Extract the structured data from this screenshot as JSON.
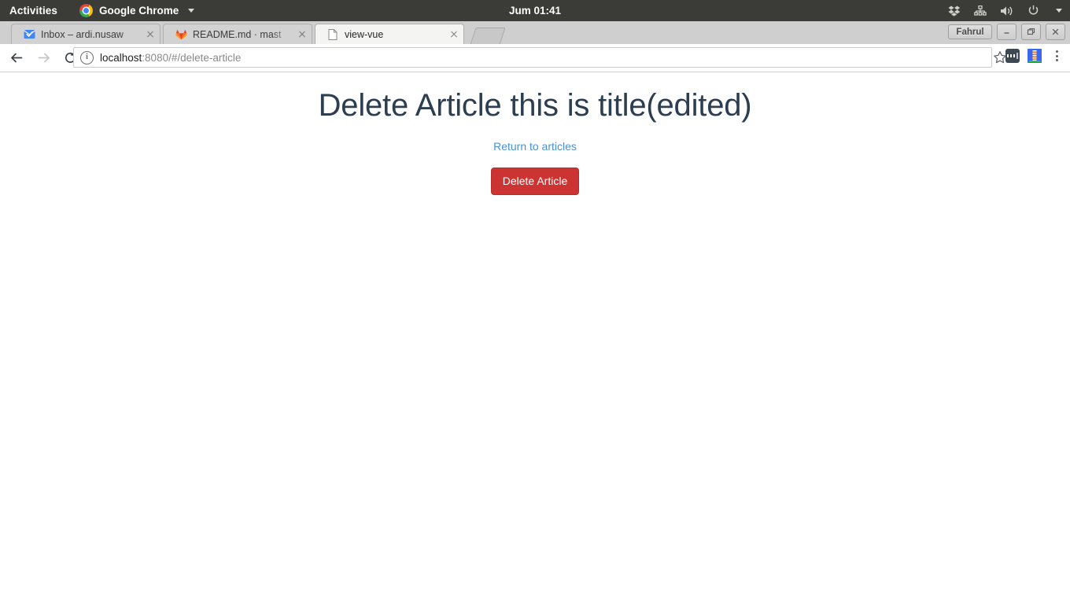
{
  "system_bar": {
    "activities_label": "Activities",
    "app_name": "Google Chrome",
    "clock": "Jum 01:41",
    "tray_icons": [
      "dropbox-icon",
      "network-icon",
      "volume-icon",
      "power-icon",
      "caret-down-icon"
    ]
  },
  "browser": {
    "tabs": [
      {
        "title": "Inbox – ardi.nusaw",
        "favicon": "gmail-icon",
        "active": false
      },
      {
        "title": "README.md · mast",
        "favicon": "gitlab-icon",
        "active": false
      },
      {
        "title": "view-vue",
        "favicon": "document-icon",
        "active": true
      }
    ],
    "new_tab_label": "New tab",
    "window_controls": {
      "profile_name": "Fahrul",
      "minimize": "–",
      "maximize": "❐",
      "close": "✕"
    },
    "toolbar": {
      "back_label": "Back",
      "forward_label": "Forward",
      "reload_label": "Reload",
      "security_icon": "i",
      "url_host": "localhost",
      "url_rest": ":8080/#/delete-article",
      "bookmark_label": "Bookmark this page",
      "extensions": [
        "extension-dark-icon",
        "extension-lighthouse-icon"
      ],
      "menu_label": "Customize and control Google Chrome"
    }
  },
  "page": {
    "title": "Delete Article this is title(edited)",
    "return_link": "Return to articles",
    "delete_button": "Delete Article",
    "colors": {
      "title": "#2c3e50",
      "link": "#4a90d9",
      "danger": "#cc3333"
    }
  }
}
